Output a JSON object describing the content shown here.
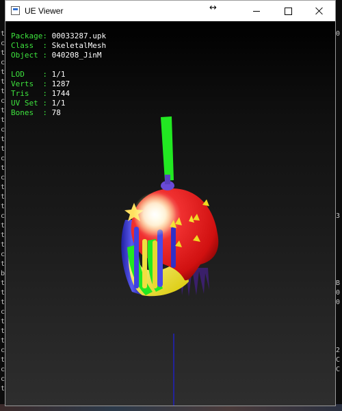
{
  "window": {
    "title": "UE Viewer",
    "resize_glyph": "↔",
    "buttons": [
      "minimize",
      "maximize",
      "close"
    ]
  },
  "info": {
    "package_label": "Package: ",
    "package_value": "00033287.upk",
    "class_label": "Class  : ",
    "class_value": "SkeletalMesh",
    "object_label": "Object : ",
    "object_value": "040208_JinM",
    "lod_label": "LOD    : ",
    "lod_value": "1/1",
    "verts_label": "Verts  : ",
    "verts_value": "1287",
    "tris_label": "Tris   : ",
    "tris_value": "1744",
    "uvset_label": "UV Set : ",
    "uvset_value": "1/1",
    "bones_label": "Bones  : ",
    "bones_value": "78"
  },
  "colors": {
    "label_green": "#3ee43e",
    "value_white": "#ffffff",
    "helmet_red": "#e01818",
    "bone_green": "#22e822",
    "bone_blue": "#3a3ad8",
    "axis_blue": "#2020c0"
  },
  "background_terminal": {
    "left_chars": [
      "t",
      "c",
      "t",
      "c",
      "t",
      "t",
      "t",
      "c",
      "t",
      "t",
      "c",
      "t",
      "t",
      "c",
      "t",
      "c",
      "t",
      "t",
      "t",
      "c",
      "t",
      "t",
      "t",
      "c",
      "t",
      "b",
      "t",
      "t",
      "t",
      "c",
      "t",
      "t",
      "t",
      "c",
      "t",
      "c",
      "c",
      "t"
    ],
    "right_chars": [
      "0",
      "",
      "",
      "",
      "",
      "",
      "",
      "",
      "",
      "",
      "",
      "",
      "",
      "",
      "",
      "",
      "",
      "",
      "",
      "3",
      "",
      "",
      "",
      "",
      "",
      "",
      "B",
      "0",
      "0",
      "",
      "",
      "",
      "",
      "2",
      "C",
      "C",
      ""
    ]
  }
}
